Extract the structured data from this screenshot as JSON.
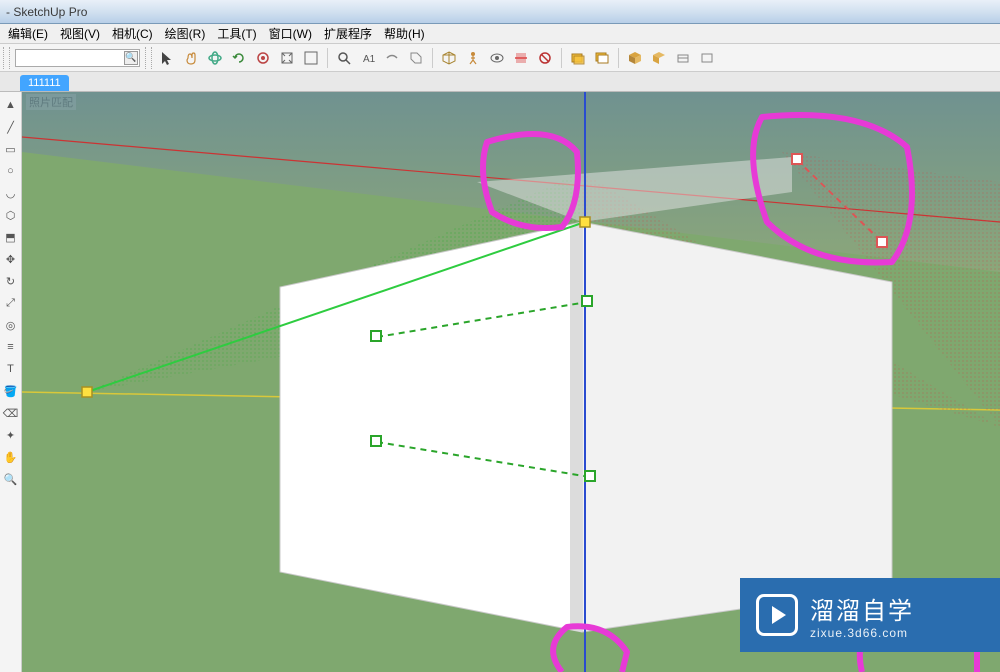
{
  "title": " - SketchUp Pro",
  "menus": [
    {
      "label": "编辑(E)"
    },
    {
      "label": "视图(V)"
    },
    {
      "label": "相机(C)"
    },
    {
      "label": "绘图(R)"
    },
    {
      "label": "工具(T)"
    },
    {
      "label": "窗口(W)"
    },
    {
      "label": "扩展程序"
    },
    {
      "label": "帮助(H)"
    }
  ],
  "scene_tab": "111111",
  "viewport_label": "照片匹配",
  "watermark": {
    "title": "溜溜自学",
    "sub": "zixue.3d66.com"
  },
  "toolbar_icons": [
    "arrow",
    "hand",
    "orbit",
    "sync",
    "target",
    "expand1",
    "expand2",
    "zoom",
    "undo",
    "redo",
    "tag",
    "iso",
    "walk",
    "look",
    "section",
    "xray",
    "layers1",
    "layers2",
    "cube1",
    "cube2",
    "slice1",
    "slice2"
  ],
  "left_icons": [
    "select",
    "line",
    "rect",
    "circle",
    "arc",
    "poly",
    "push",
    "move",
    "rotate",
    "scale",
    "offset",
    "tape",
    "text",
    "paint",
    "eraser",
    "orbit2",
    "pan2",
    "zoom2"
  ]
}
